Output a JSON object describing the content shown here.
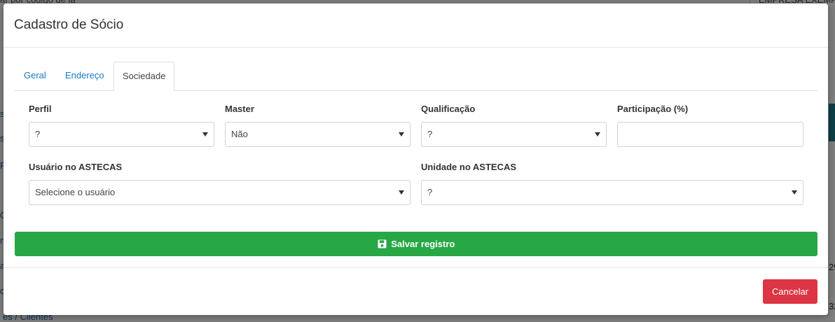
{
  "background": {
    "search_placeholder": "ar por código de la",
    "company": "EMPRESA EXEMP",
    "side_items": [
      "s",
      "s",
      "F",
      "C",
      "m",
      "a",
      "o"
    ],
    "right_values": [
      "29",
      "32"
    ],
    "bottom_link": "es / Clientes"
  },
  "modal": {
    "title": "Cadastro de Sócio",
    "tabs": [
      {
        "label": "Geral",
        "active": false
      },
      {
        "label": "Endereço",
        "active": false
      },
      {
        "label": "Sociedade",
        "active": true
      }
    ]
  },
  "form": {
    "perfil": {
      "label": "Perfil",
      "value": "?"
    },
    "master": {
      "label": "Master",
      "value": "Não"
    },
    "qualificacao": {
      "label": "Qualificação",
      "value": "?"
    },
    "participacao": {
      "label": "Participação (%)",
      "value": ""
    },
    "usuario": {
      "label": "Usuário no ASTECAS",
      "value": "Selecione o usuário"
    },
    "unidade": {
      "label": "Unidade no ASTECAS",
      "value": "?"
    }
  },
  "buttons": {
    "save_label": "Salvar registro",
    "cancel_label": "Cancelar"
  },
  "colors": {
    "save": "#28a745",
    "cancel": "#dc3545",
    "link": "#1a7bc9"
  }
}
